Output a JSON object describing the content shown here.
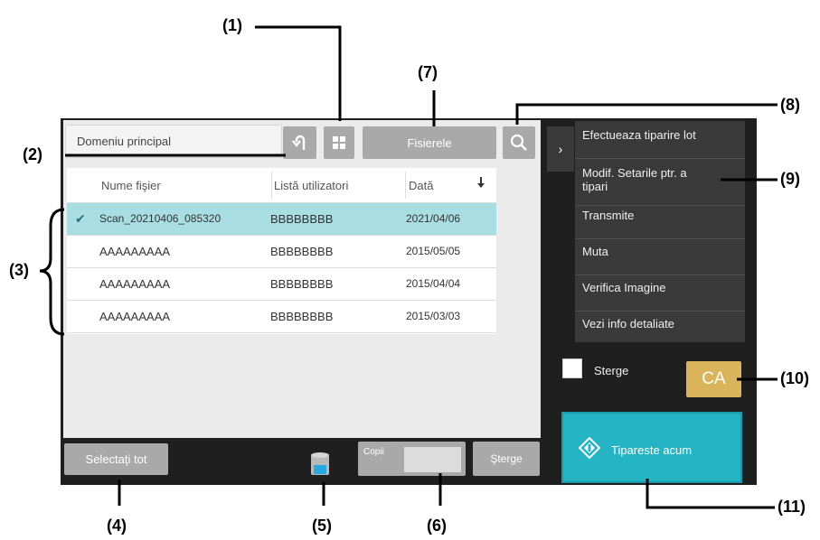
{
  "breadcrumb": "Domeniu principal",
  "toolbar": {
    "files_label": "Fisierele"
  },
  "table": {
    "headers": [
      "Nume fişier",
      "Listă utilizatori",
      "Dată"
    ],
    "rows": [
      {
        "name": "Scan_20210406_085320",
        "user": "BBBBBBBB",
        "date": "2021/04/06",
        "selected": true
      },
      {
        "name": "AAAAAAAAA",
        "user": "BBBBBBBB",
        "date": "2015/05/05",
        "selected": false
      },
      {
        "name": "AAAAAAAAA",
        "user": "BBBBBBBB",
        "date": "2015/04/04",
        "selected": false
      },
      {
        "name": "AAAAAAAAA",
        "user": "BBBBBBBB",
        "date": "2015/03/03",
        "selected": false
      }
    ]
  },
  "bottom": {
    "select_all": "Selectaţi tot",
    "copies_label": "Copii",
    "copies_value": "",
    "delete": "Şterge"
  },
  "side_menu": {
    "items": [
      "Efectueaza tiparire lot",
      "Modif. Setarile ptr. a tipari",
      "Transmite",
      "Muta",
      "Verifica Imagine",
      "Vezi info detaliate"
    ],
    "checkbox_label": "Sterge",
    "ca_label": "CA",
    "print_label": "Tipareste acum"
  },
  "callouts": {
    "c1": "(1)",
    "c2": "(2)",
    "c3": "(3)",
    "c4": "(4)",
    "c5": "(5)",
    "c6": "(6)",
    "c7": "(7)",
    "c8": "(8)",
    "c9": "(9)",
    "c10": "(10)",
    "c11": "(11)"
  },
  "colors": {
    "selected_row": "#a8dde2",
    "print_button": "#25b4c4",
    "ca_button": "#d9b45a",
    "menu_bg": "#3a3a3a"
  }
}
